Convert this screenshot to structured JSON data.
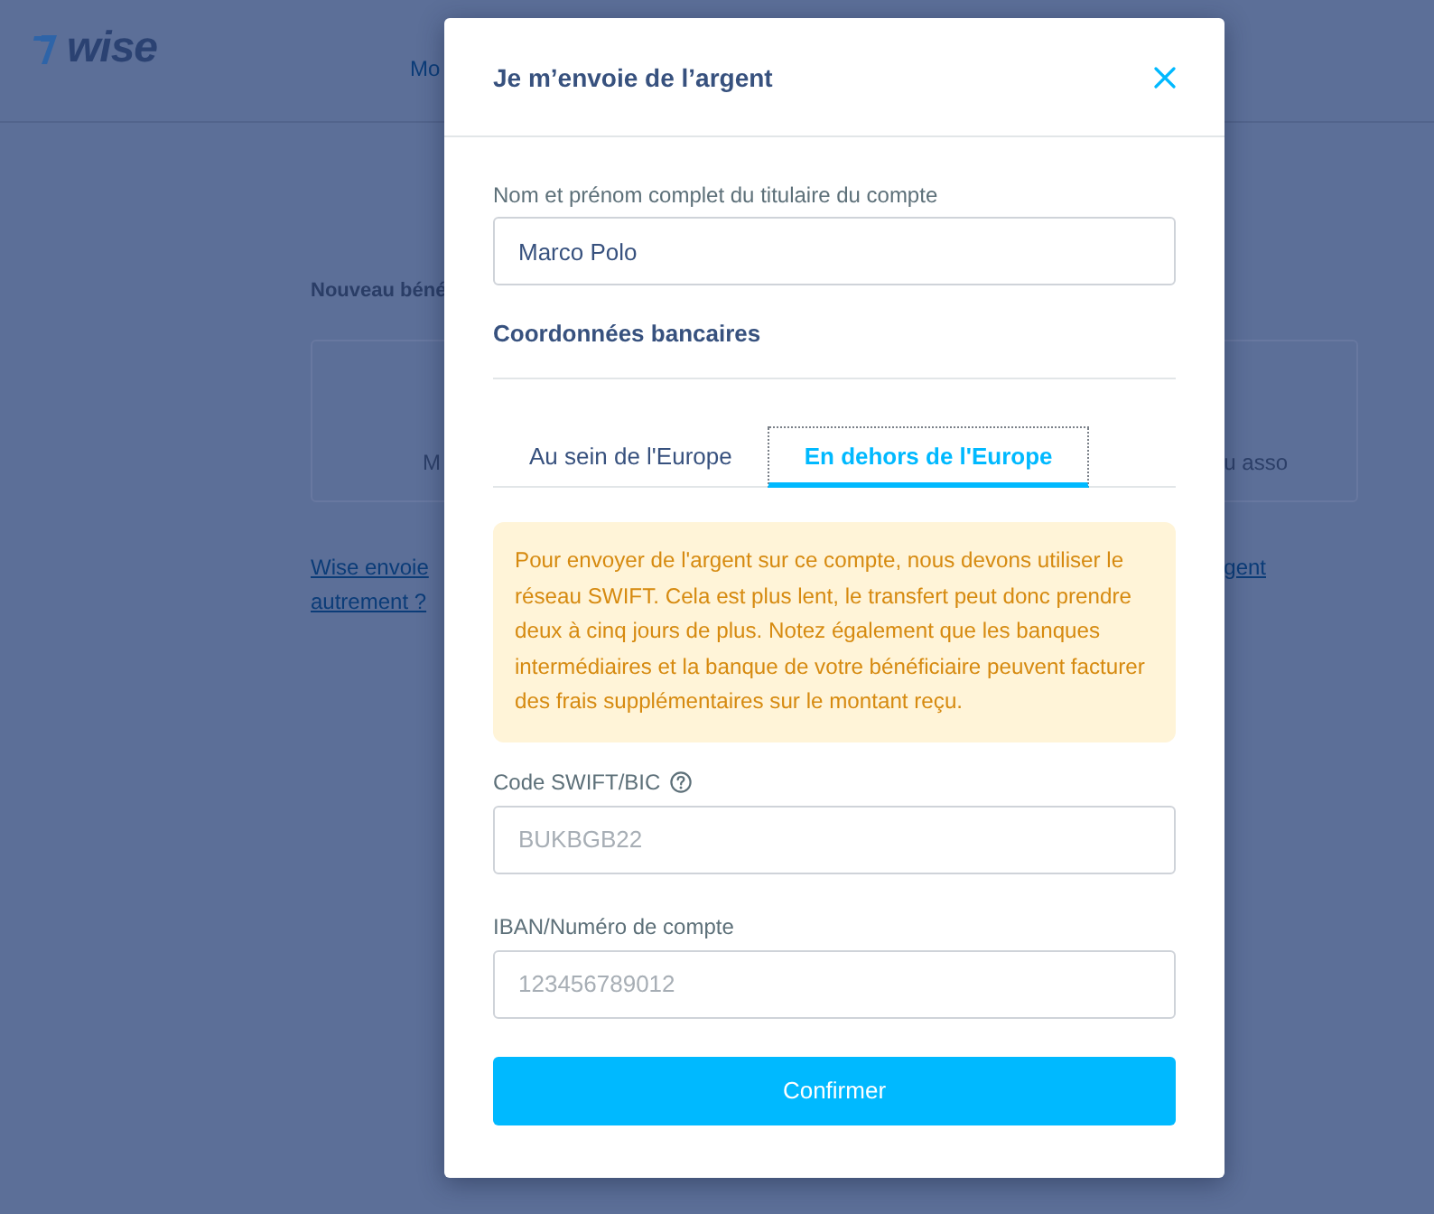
{
  "background_page": {
    "logo": {
      "text": "wise"
    },
    "nav": [
      {
        "label": "Mo"
      }
    ],
    "section_label": "Nouveau béné",
    "card": {
      "left_text": "M",
      "right_text": "u asso"
    },
    "links_left": [
      "Wise envoie",
      "autrement ?"
    ],
    "links_right": [
      "gent"
    ]
  },
  "dialog": {
    "title": "Je m’envoie de l’argent",
    "name_field": {
      "label": "Nom et prénom complet du titulaire du compte",
      "value": "Marco Polo"
    },
    "section_title": "Coordonnées bancaires",
    "tabs": [
      {
        "label": "Au sein de l'Europe",
        "selected": false
      },
      {
        "label": "En dehors de l'Europe",
        "selected": true
      }
    ],
    "alert": {
      "text": "Pour envoyer de l'argent sur ce compte, nous devons utiliser le réseau SWIFT. Cela est plus lent, le transfert peut donc prendre deux à cinq jours de plus. Notez également que les banques intermédiaires et la banque de votre bénéficiaire peuvent facturer des frais supplémentaires sur le montant reçu."
    },
    "fields": [
      {
        "label": "Code SWIFT/BIC",
        "help": true,
        "placeholder": "BUKBGB22"
      },
      {
        "label": "IBAN/Numéro de compte",
        "help": false,
        "placeholder": "123456789012"
      }
    ],
    "submit_button": "Confirmer"
  }
}
